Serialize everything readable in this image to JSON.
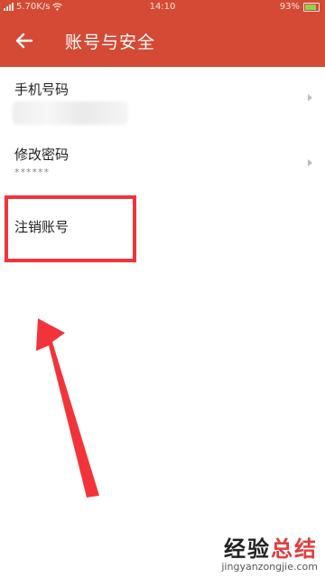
{
  "status_bar": {
    "network_speed": "5.70K/s",
    "time": "14:10",
    "battery_percent": "93%"
  },
  "app_bar": {
    "title": "账号与安全"
  },
  "settings": {
    "items": [
      {
        "label": "手机号码",
        "sub": ""
      },
      {
        "label": "修改密码",
        "sub": "******"
      },
      {
        "label": "注销账号",
        "sub": ""
      }
    ]
  },
  "watermark": {
    "title_part1": "经验",
    "title_part2": "总结",
    "url": "jingyanzongjie.com"
  },
  "colors": {
    "header": "#d44a34",
    "highlight": "#f2343a"
  }
}
